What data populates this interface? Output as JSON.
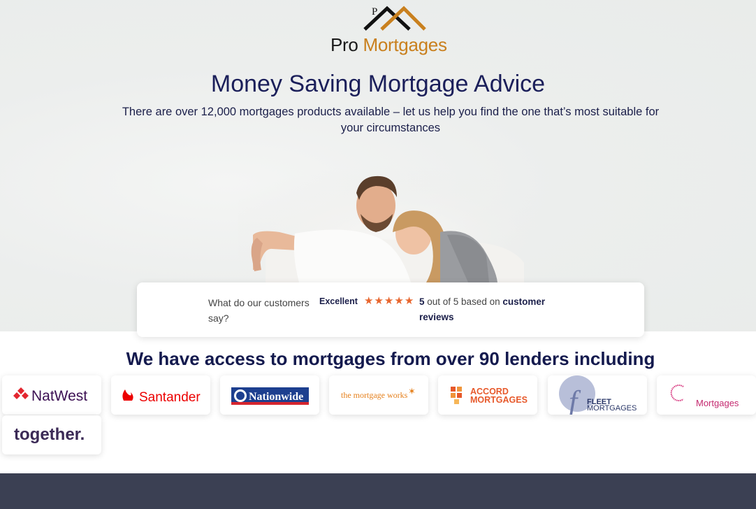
{
  "brand": {
    "logo_pro": "Pro",
    "logo_mortgages": "Mortgages",
    "logo_mark_letter": "P",
    "colors": {
      "navy": "#1b1f5a",
      "gold": "#c9801e",
      "star_orange": "#e8662e",
      "footer": "#3b4053"
    }
  },
  "hero": {
    "title": "Money Saving Mortgage Advice",
    "subtitle": "There are over 12,000 mortgages products available – let us help you find the one that’s most suitable for your circumstances",
    "image_alt": "couple relaxing on sofa"
  },
  "reviews": {
    "question": "What do our customers say?",
    "rating_word": "Excellent",
    "stars": 5,
    "score_bold": "5",
    "score_text": " out of 5 based on ",
    "score_link": "customer reviews"
  },
  "lenders": {
    "heading": "We have access to mortgages from over 90 lenders including",
    "items": [
      {
        "name": "NatWest"
      },
      {
        "name": "Santander"
      },
      {
        "name": "Nationwide"
      },
      {
        "name": "the mortgage works"
      },
      {
        "name": "ACCORD MORTGAGES",
        "line1": "ACCORD",
        "line2": "MORTGAGES"
      },
      {
        "name": "FLEET MORTGAGES",
        "line1": "FLEET",
        "line2": "MORTGAGES",
        "mark": "f"
      },
      {
        "name": "Mortgages"
      },
      {
        "name": "together."
      }
    ]
  }
}
